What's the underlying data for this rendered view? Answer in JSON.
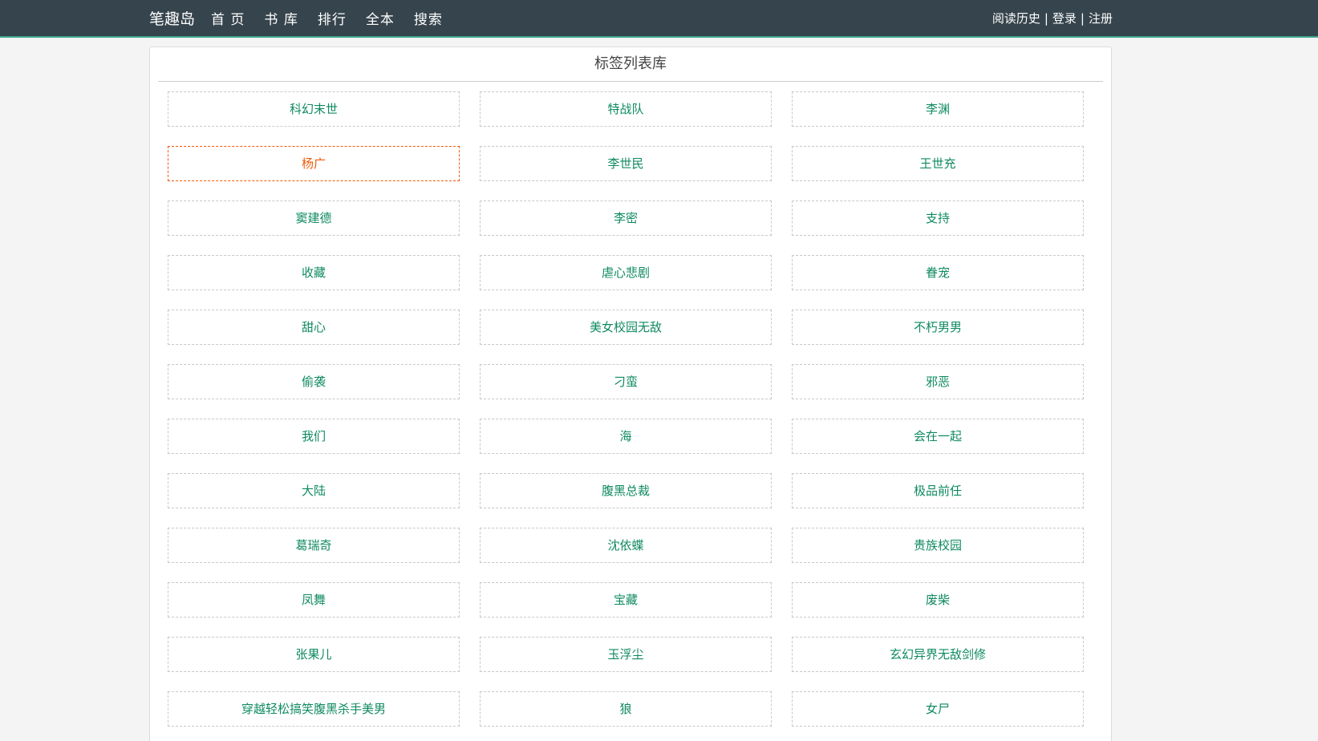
{
  "header": {
    "logo": "笔趣岛",
    "nav": [
      "首 页",
      "书 库",
      "排行",
      "全本",
      "搜索"
    ],
    "user": {
      "history": "阅读历史",
      "separator": "|",
      "login": "登录",
      "register": "注册"
    }
  },
  "panel": {
    "title": "标签列表库"
  },
  "tags": [
    {
      "label": "科幻末世"
    },
    {
      "label": "特战队"
    },
    {
      "label": "李渊"
    },
    {
      "label": "杨广",
      "hover": true
    },
    {
      "label": "李世民"
    },
    {
      "label": "王世充"
    },
    {
      "label": "窦建德"
    },
    {
      "label": "李密"
    },
    {
      "label": "支持"
    },
    {
      "label": "收藏"
    },
    {
      "label": "虐心悲剧"
    },
    {
      "label": "眷宠"
    },
    {
      "label": "甜心"
    },
    {
      "label": "美女校园无敌"
    },
    {
      "label": "不朽男男"
    },
    {
      "label": "偷袭"
    },
    {
      "label": "刁蛮"
    },
    {
      "label": "邪恶"
    },
    {
      "label": "我们"
    },
    {
      "label": "海"
    },
    {
      "label": "会在一起"
    },
    {
      "label": "大陆"
    },
    {
      "label": "腹黑总裁"
    },
    {
      "label": "极品前任"
    },
    {
      "label": "葛瑞奇"
    },
    {
      "label": "沈依蝶"
    },
    {
      "label": "贵族校园"
    },
    {
      "label": "凤舞"
    },
    {
      "label": "宝藏"
    },
    {
      "label": "废柴"
    },
    {
      "label": "张果儿"
    },
    {
      "label": "玉浮尘"
    },
    {
      "label": "玄幻异界无敌剑修"
    },
    {
      "label": "穿越轻松搞笑腹黑杀手美男"
    },
    {
      "label": "狼"
    },
    {
      "label": "女尸"
    }
  ],
  "colors": {
    "topbar": "#36444d",
    "topbar_accent": "#3fa28a",
    "tag_text": "#0e8a5f",
    "tag_hover": "#f05a0a"
  }
}
